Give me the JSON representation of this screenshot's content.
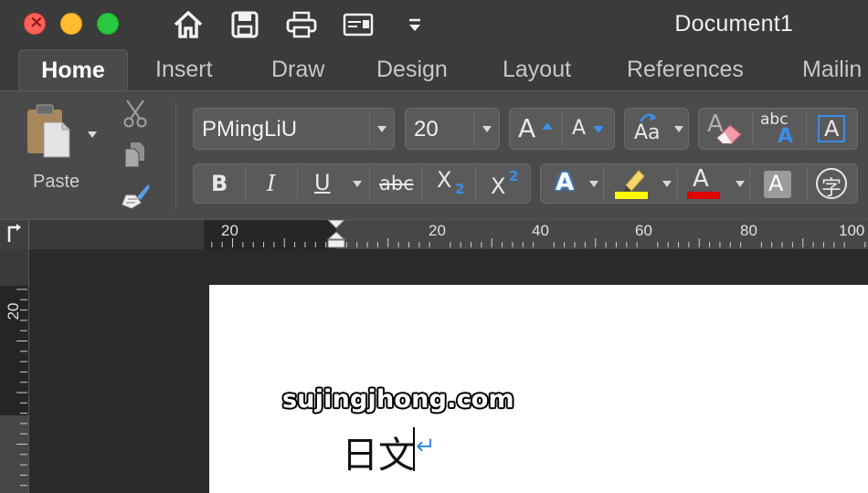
{
  "window": {
    "title": "Document1",
    "traffic_lights": [
      "close",
      "minimize",
      "zoom"
    ]
  },
  "quick_access": [
    {
      "name": "home-icon"
    },
    {
      "name": "save-icon"
    },
    {
      "name": "print-icon"
    },
    {
      "name": "display-icon"
    },
    {
      "name": "customize-toolbar-icon"
    }
  ],
  "tabs": [
    "Home",
    "Insert",
    "Draw",
    "Design",
    "Layout",
    "References",
    "Mailin"
  ],
  "ribbon": {
    "paste_label": "Paste",
    "font_name": "PMingLiU",
    "font_size": "20",
    "bold_glyph": "B",
    "italic_glyph": "I",
    "underline_glyph": "U",
    "strike_glyph": "abc",
    "sub_glyph": "X",
    "sub_digit": "2",
    "sup_glyph": "X",
    "sup_digit": "2",
    "grow_glyph": "A",
    "shrink_glyph": "A",
    "case_glyph": "Aa",
    "clear_glyph": "A",
    "phonetic_top": "abc",
    "phonetic_bottom": "A",
    "charborder_glyph": "A",
    "effects_glyph": "A",
    "color_glyph": "A",
    "shading_glyph": "A",
    "enclose_glyph": "字",
    "colors": {
      "highlight": "#ffff00",
      "font_color": "#e00000",
      "accent": "#3a8ee6"
    }
  },
  "ruler": {
    "labels": [
      "20",
      "20",
      "40",
      "60",
      "80",
      "100"
    ],
    "vertical_label": "20"
  },
  "document": {
    "watermark": "sujingjhong.com",
    "text": "日文",
    "paragraph_mark": "↵"
  }
}
